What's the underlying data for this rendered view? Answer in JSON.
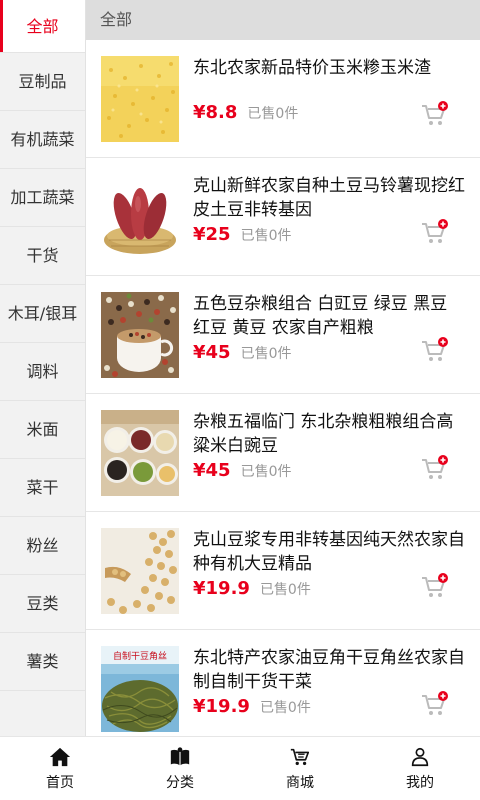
{
  "sidebar": {
    "items": [
      {
        "label": "全部",
        "active": true
      },
      {
        "label": "豆制品"
      },
      {
        "label": "有机蔬菜"
      },
      {
        "label": "加工蔬菜"
      },
      {
        "label": "干货"
      },
      {
        "label": "木耳/银耳"
      },
      {
        "label": "调料"
      },
      {
        "label": "米面"
      },
      {
        "label": "菜干"
      },
      {
        "label": "粉丝"
      },
      {
        "label": "豆类"
      },
      {
        "label": "薯类"
      }
    ]
  },
  "header": {
    "title": "全部"
  },
  "products": [
    {
      "name": "东北农家新品特价玉米糁玉米渣",
      "price": "¥8.8",
      "sold": "已售0件",
      "image": "corn-grits-photo"
    },
    {
      "name": "克山新鲜农家自种土豆马铃薯现挖红皮土豆非转基因",
      "price": "¥25",
      "sold": "已售0件",
      "image": "red-potatoes-basket-photo"
    },
    {
      "name": "五色豆杂粮组合 白豇豆 绿豆 黑豆 红豆 黄豆 农家自产粗粮",
      "price": "¥45",
      "sold": "已售0件",
      "image": "mixed-beans-cup-photo"
    },
    {
      "name": "杂粮五福临门 东北杂粮粗粮组合高粱米白豌豆",
      "price": "¥45",
      "sold": "已售0件",
      "image": "grain-bowls-photo"
    },
    {
      "name": "克山豆浆专用非转基因纯天然农家自种有机大豆精品",
      "price": "¥19.9",
      "sold": "已售0件",
      "image": "soybeans-photo"
    },
    {
      "name": "东北特产农家油豆角干豆角丝农家自制自制干货干菜",
      "price": "¥19.9",
      "sold": "已售0件",
      "image": "dried-beans-package-photo",
      "badge": "自制干豆角丝"
    }
  ],
  "tabs": [
    {
      "label": "首页",
      "icon": "home-icon"
    },
    {
      "label": "分类",
      "icon": "book-icon"
    },
    {
      "label": "商城",
      "icon": "cart-icon"
    },
    {
      "label": "我的",
      "icon": "user-icon"
    }
  ],
  "colors": {
    "accent": "#e8001c",
    "sidebar_bg": "#f2f2f2",
    "header_bg": "#dddddd"
  }
}
